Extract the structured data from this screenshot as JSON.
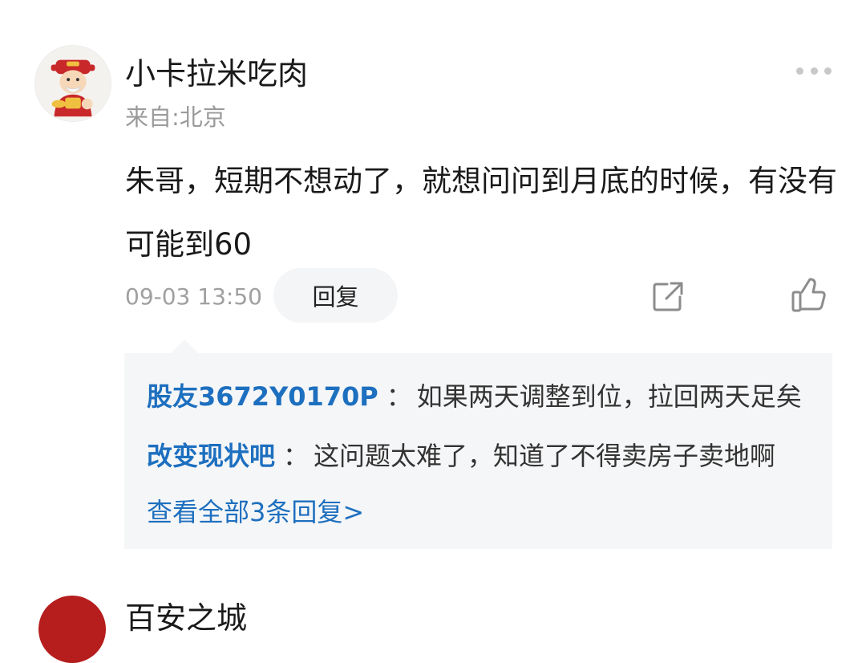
{
  "comment": {
    "username": "小卡拉米吃肉",
    "location": "来自:北京",
    "content": "朱哥，短期不想动了，就想问问到月底的时候，有没有可能到60",
    "time": "09-03 13:50",
    "reply_label": "回复",
    "more_icon": "more-dots-icon",
    "share_icon": "share-icon",
    "like_icon": "thumbs-up-icon"
  },
  "replies": {
    "items": [
      {
        "author": "股友3672Y0170P",
        "sep": "：",
        "text": "如果两天调整到位，拉回两天足矣"
      },
      {
        "author": "改变现状吧",
        "sep": "：",
        "text": "这问题太难了，知道了不得卖房子卖地啊"
      }
    ],
    "view_all": "查看全部3条回复>"
  },
  "next_comment": {
    "username": "百安之城"
  },
  "colors": {
    "link": "#1d6fbf",
    "muted": "#9a9a9a",
    "reply_bg": "#f5f6f7"
  }
}
